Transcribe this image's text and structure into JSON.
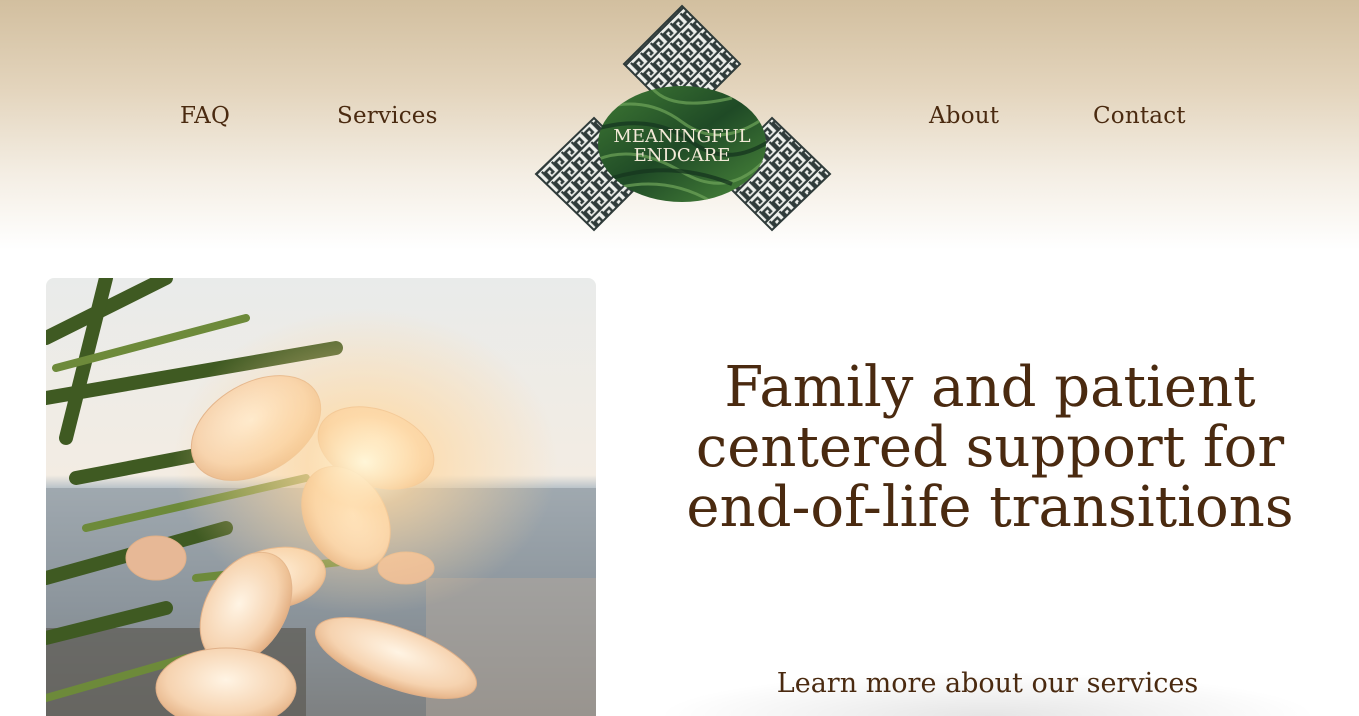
{
  "nav": {
    "faq": "FAQ",
    "services": "Services",
    "about": "About",
    "contact": "Contact"
  },
  "logo": {
    "line1": "MEANINGFUL",
    "line2": "ENDCARE"
  },
  "hero": {
    "headline": "Family and patient centered support for end-of-life transitions",
    "cta": "Learn more about our services"
  },
  "colors": {
    "text": "#4a2a10",
    "header_top": "#d2bf9f",
    "logo_green": "#2e5a2a",
    "pattern_dark": "#2f3b3a"
  }
}
